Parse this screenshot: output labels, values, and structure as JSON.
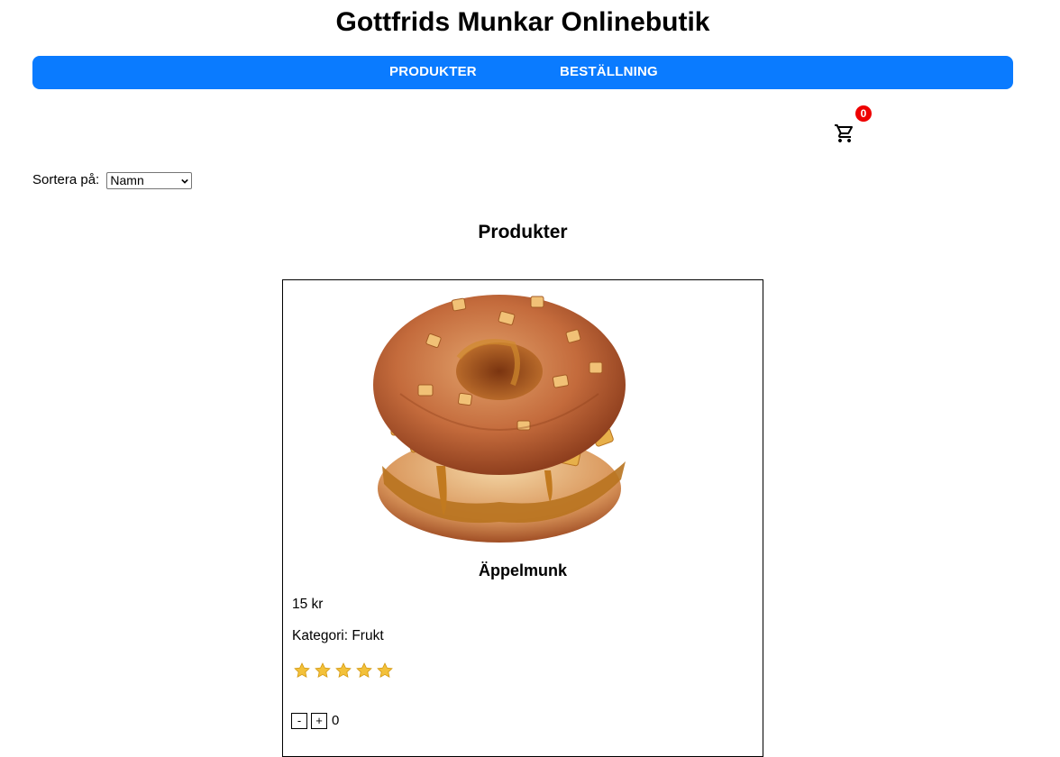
{
  "header": {
    "title": "Gottfrids Munkar Onlinebutik"
  },
  "nav": {
    "items": [
      {
        "label": "PRODUKTER"
      },
      {
        "label": "BESTÄLLNING"
      }
    ],
    "background_color": "#0a7bff"
  },
  "cart": {
    "icon": "shopping-cart-icon",
    "count": "0",
    "badge_color": "#ee0000"
  },
  "sort": {
    "label": "Sortera på:",
    "selected": "Namn"
  },
  "products_section": {
    "title": "Produkter"
  },
  "products": [
    {
      "name": "Äppelmunk",
      "price": "15 kr",
      "category": "Kategori: Frukt",
      "image": "apple-donut-image",
      "rating": 5,
      "rating_max": 5,
      "quantity_decrease": "-",
      "quantity_increase": "+",
      "quantity": "0"
    }
  ]
}
